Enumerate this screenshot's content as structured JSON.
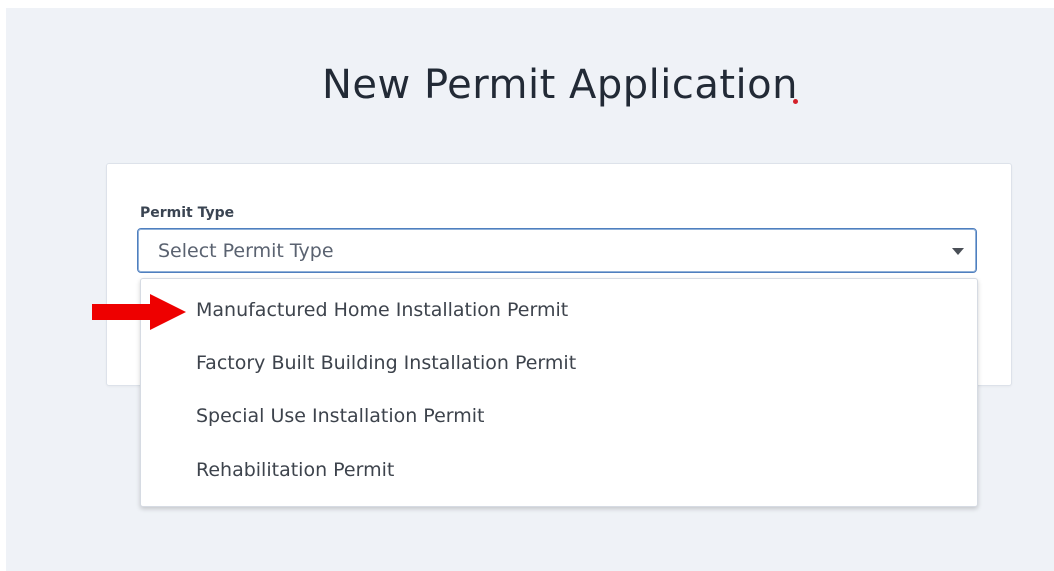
{
  "page": {
    "title": "New Permit Application"
  },
  "form": {
    "permit_type": {
      "label": "Permit Type",
      "placeholder": "Select Permit Type",
      "options": [
        "Manufactured Home Installation Permit",
        "Factory Built Building Installation Permit",
        "Special Use Installation Permit",
        "Rehabilitation Permit"
      ]
    }
  },
  "annotation": {
    "arrow_color": "#ee0000",
    "points_to": "Manufactured Home Installation Permit"
  },
  "colors": {
    "background": "#eff2f7",
    "title": "#222a36",
    "select_border": "#4f7fbf"
  }
}
